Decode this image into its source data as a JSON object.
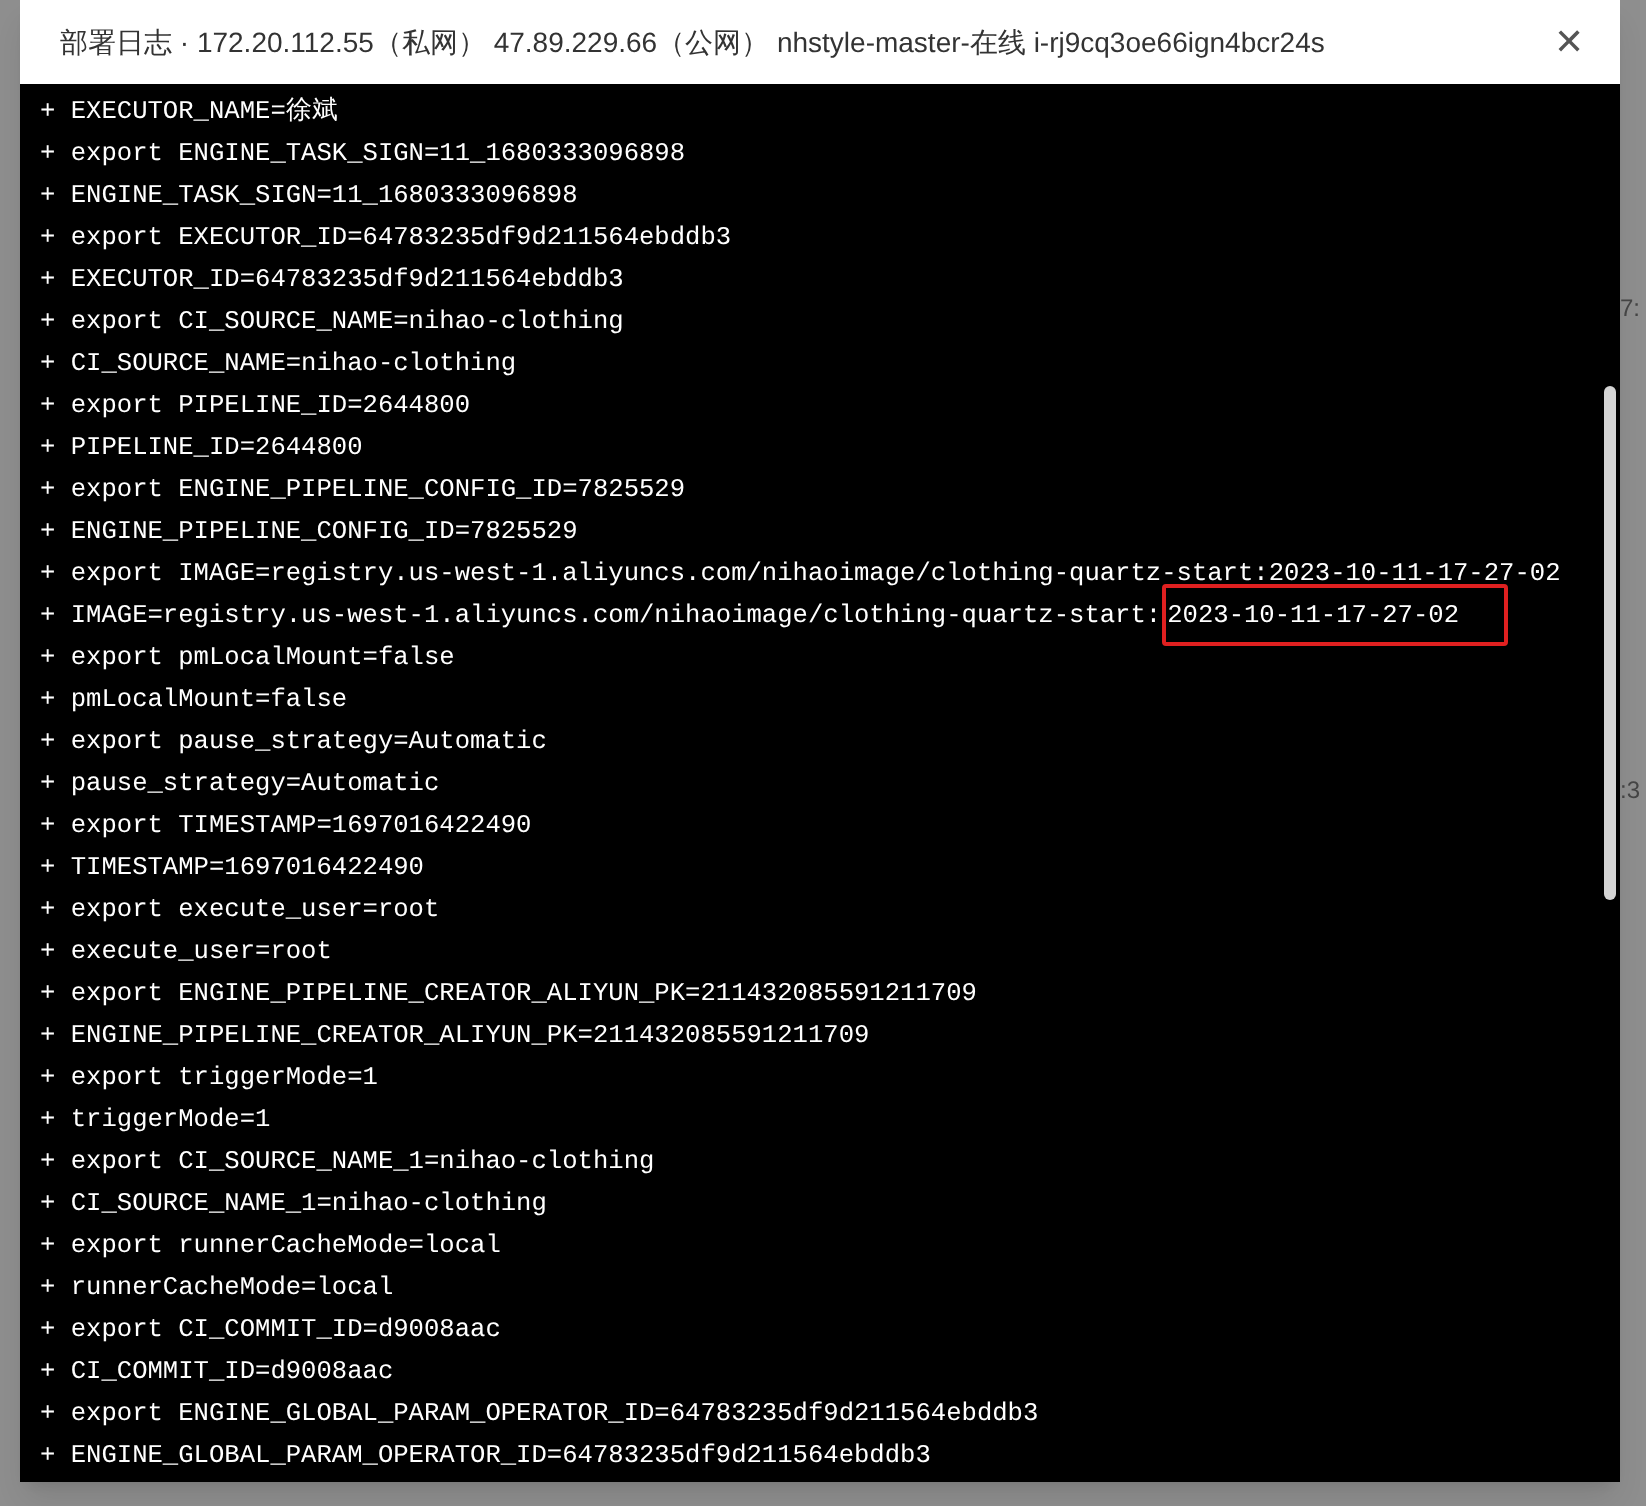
{
  "backdrop": {
    "right_fragments": [
      "7:",
      ":3"
    ]
  },
  "dialog": {
    "title": "部署日志 · 172.20.112.55（私网） 47.89.229.66（公网） nhstyle-master-在线 i-rj9cq3oe66ign4bcr24s",
    "close": "✕"
  },
  "log": {
    "lines": [
      {
        "text": "+ EXECUTOR_NAME=徐斌"
      },
      {
        "text": "+ export ENGINE_TASK_SIGN=11_1680333096898"
      },
      {
        "text": "+ ENGINE_TASK_SIGN=11_1680333096898"
      },
      {
        "text": "+ export EXECUTOR_ID=64783235df9d211564ebddb3"
      },
      {
        "text": "+ EXECUTOR_ID=64783235df9d211564ebddb3"
      },
      {
        "text": "+ export CI_SOURCE_NAME=nihao-clothing"
      },
      {
        "text": "+ CI_SOURCE_NAME=nihao-clothing"
      },
      {
        "text": "+ export PIPELINE_ID=2644800"
      },
      {
        "text": "+ PIPELINE_ID=2644800"
      },
      {
        "text": "+ export ENGINE_PIPELINE_CONFIG_ID=7825529"
      },
      {
        "text": "+ ENGINE_PIPELINE_CONFIG_ID=7825529"
      },
      {
        "text": "+ export IMAGE=registry.us-west-1.aliyuncs.com/nihaoimage/clothing-quartz-start:2023-10-11-17-27-02"
      },
      {
        "text": "+ IMAGE=registry.us-west-1.aliyuncs.com/nihaoimage/clothing-quartz-start:",
        "boxed": "2023-10-11-17-27-02"
      },
      {
        "text": "+ export pmLocalMount=false"
      },
      {
        "text": "+ pmLocalMount=false"
      },
      {
        "text": "+ export pause_strategy=Automatic"
      },
      {
        "text": "+ pause_strategy=Automatic"
      },
      {
        "text": "+ export TIMESTAMP=1697016422490"
      },
      {
        "text": "+ TIMESTAMP=1697016422490"
      },
      {
        "text": "+ export execute_user=root"
      },
      {
        "text": "+ execute_user=root"
      },
      {
        "text": "+ export ENGINE_PIPELINE_CREATOR_ALIYUN_PK=211432085591211709"
      },
      {
        "text": "+ ENGINE_PIPELINE_CREATOR_ALIYUN_PK=211432085591211709"
      },
      {
        "text": "+ export triggerMode=1"
      },
      {
        "text": "+ triggerMode=1"
      },
      {
        "text": "+ export CI_SOURCE_NAME_1=nihao-clothing"
      },
      {
        "text": "+ CI_SOURCE_NAME_1=nihao-clothing"
      },
      {
        "text": "+ export runnerCacheMode=local"
      },
      {
        "text": "+ runnerCacheMode=local"
      },
      {
        "text": "+ export CI_COMMIT_ID=d9008aac"
      },
      {
        "text": "+ CI_COMMIT_ID=d9008aac"
      },
      {
        "text": "+ export ENGINE_GLOBAL_PARAM_OPERATOR_ID=64783235df9d211564ebddb3"
      },
      {
        "text": "+ ENGINE_GLOBAL_PARAM_OPERATOR_ID=64783235df9d211564ebddb3"
      }
    ]
  }
}
